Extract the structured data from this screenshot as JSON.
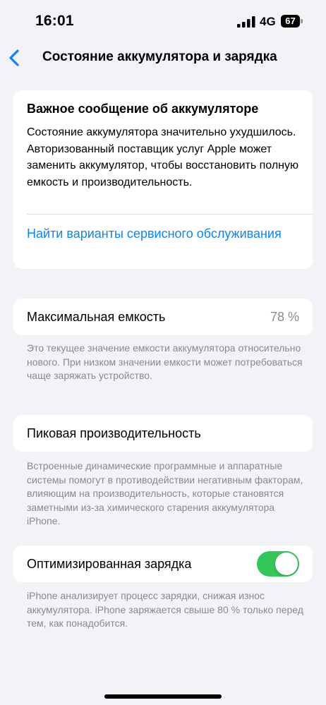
{
  "status_bar": {
    "time": "16:01",
    "network": "4G",
    "battery_level": "67",
    "signal_icon": "cellular-signal-icon",
    "battery_icon": "battery-icon"
  },
  "nav": {
    "back_icon": "chevron-left-icon",
    "title": "Состояние аккумулятора и зарядка"
  },
  "alert": {
    "title": "Важное сообщение об аккумуляторе",
    "body": "Состояние аккумулятора значительно ухудшилось. Авторизованный поставщик услуг Apple может заменить аккумулятор, чтобы восстановить полную емкость и производительность.",
    "link": "Найти варианты сервисного обслуживания"
  },
  "capacity": {
    "label": "Максимальная емкость",
    "value": "78 %",
    "note": "Это текущее значение емкости аккумулятора относительно нового. При низком значении емкости может потребоваться чаще заряжать устройство."
  },
  "peak": {
    "label": "Пиковая производительность",
    "note": "Встроенные динамические программные и аппаратные системы помогут в противодействии негативным факторам, влияющим на производительность, которые становятся заметными из-за химического старения аккумулятора iPhone."
  },
  "charging": {
    "label": "Оптимизированная зарядка",
    "enabled": true,
    "note": "iPhone анализирует процесс зарядки, снижая износ аккумулятора. iPhone заряжается свыше 80 % только перед тем, как понадобится."
  },
  "colors": {
    "accent": "#0a84ff",
    "toggle_on": "#34c759",
    "background": "#f2f2f7",
    "secondary_text": "#8a8a8e"
  }
}
